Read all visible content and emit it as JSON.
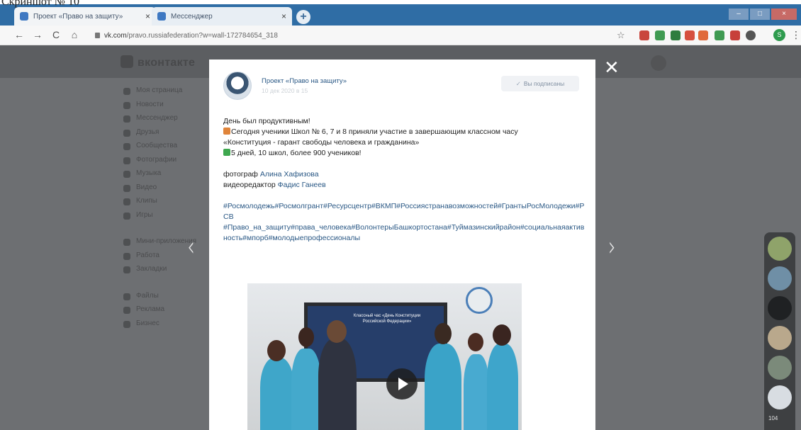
{
  "caption": "Скриншот № 10",
  "browser": {
    "tabs": [
      {
        "title": "Проект «Право на защиту»",
        "close": "×"
      },
      {
        "title": "Мессенджер",
        "close": "×"
      }
    ],
    "new_tab": "+",
    "window_controls": [
      "–",
      "□",
      "×"
    ],
    "nav": {
      "back": "←",
      "forward": "→",
      "reload": "C",
      "home": "⌂"
    },
    "address": {
      "domain": "vk.com",
      "path": "/pravo.russiafederation?w=wall-172784654_318"
    },
    "star": "☆",
    "extension_colors": [
      "#c9463d",
      "#3f9a52",
      "#2e7d3f",
      "#d6503f",
      "#e06a3a",
      "#3f9a52",
      "#c7403a",
      "#555555"
    ],
    "profile_initial": "S",
    "menu": "⋮"
  },
  "vk": {
    "logo": "вконтакте",
    "left_nav": [
      "Моя страница",
      "Новости",
      "Мессенджер",
      "Друзья",
      "Сообщества",
      "Фотографии",
      "Музыка",
      "Видео",
      "Клипы",
      "Игры",
      "",
      "Мини-приложения",
      "Работа",
      "Закладки",
      "",
      "Файлы",
      "Реклама",
      "Бизнес"
    ],
    "right_col": [
      "",
      "",
      "",
      "",
      "",
      "",
      "",
      "",
      "",
      "",
      "",
      "",
      "",
      ""
    ],
    "prev_arrow": "‹",
    "next_arrow": "›",
    "close": "✕",
    "chat_count": "104"
  },
  "post": {
    "author": "Проект «Право на защиту»",
    "date": "10 дек 2020 в 15",
    "subscribe_label": "Вы подписаны",
    "lines": {
      "l1": "День был продуктивным!",
      "l2": "Сегодня ученики Школ № 6, 7 и 8 приняли участие в завершающим классном часу",
      "l3": "«Конституция - гарант свободы человека и гражданина»",
      "l4": "5 дней, 10 школ, более 900 учеников!",
      "photographer_label": "фотограф ",
      "photographer_name": "Алина Хафизова",
      "editor_label": "видеоредактор ",
      "editor_name": "Фадис Ганеев",
      "tags1": "#Росмолодежь#Росмолгрант#Ресурсцентр#ВКМП#Россиястранавозможностей#ГрантыРосМолодежи#РСВ",
      "tags2": "#Право_на_защиту#права_человека#ВолонтерыБашкортостана#Туймазинскийрайон#социальнаяактивность#мпорб#молодыепрофессионалы"
    },
    "emoji_colors": {
      "gift": "#e0843a",
      "check": "#3fa84f"
    },
    "video_screen_text": "Классный час «День Конституции Российской Федерации»"
  }
}
